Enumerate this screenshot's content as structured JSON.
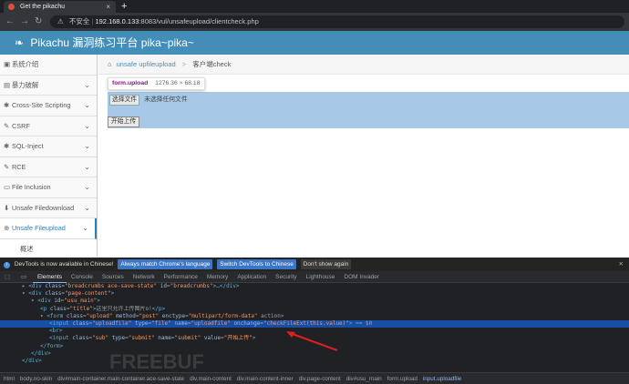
{
  "browser": {
    "tab_title": "Get the pikachu",
    "new_tab_icon": "+",
    "security_label": "不安全",
    "url_host": "192.168.0.133",
    "url_rest": ":8083/vul/unsafeupload/clientcheck.php"
  },
  "site": {
    "title": "Pikachu 漏洞练习平台 pika~pika~"
  },
  "sidebar": {
    "items": [
      {
        "label": "系统介绍",
        "icon": "desktop-icon",
        "chevron": false
      },
      {
        "label": "暴力破解",
        "icon": "list-icon",
        "chevron": true
      },
      {
        "label": "Cross-Site Scripting",
        "icon": "bug-icon",
        "chevron": true
      },
      {
        "label": "CSRF",
        "icon": "edit-icon",
        "chevron": true
      },
      {
        "label": "SQL-Inject",
        "icon": "bug-icon",
        "chevron": true
      },
      {
        "label": "RCE",
        "icon": "wrench-icon",
        "chevron": true
      },
      {
        "label": "File Inclusion",
        "icon": "file-icon",
        "chevron": true
      },
      {
        "label": "Unsafe Filedownload",
        "icon": "download-icon",
        "chevron": true
      },
      {
        "label": "Unsafe Fileupload",
        "icon": "upload-icon",
        "chevron": true,
        "active": true
      },
      {
        "label": "概述",
        "icon": "",
        "chevron": false,
        "sub": true
      }
    ]
  },
  "breadcrumb": {
    "link": "unsafe upfileupload",
    "current": "客户端check"
  },
  "page": {
    "tooltip_name": "form.upload",
    "tooltip_size": "1276.36 × 68.18",
    "choose_button": "选择文件",
    "no_file": "未选择任何文件",
    "submit_label": "开始上传"
  },
  "devtools": {
    "info_text": "DevTools is now available in Chinese!",
    "btn_always": "Always match Chrome's language",
    "btn_switch": "Switch DevTools to Chinese",
    "btn_dont": "Don't show again",
    "tabs": [
      "Elements",
      "Console",
      "Sources",
      "Network",
      "Performance",
      "Memory",
      "Application",
      "Security",
      "Lighthouse",
      "DOM Invader"
    ],
    "lines": [
      {
        "indent": 4,
        "html": "▸ <div class=\"breadcrumbs ace-save-state\" id=\"breadcrumbs\">…</div>"
      },
      {
        "indent": 4,
        "html": "▾ <div class=\"page-content\">"
      },
      {
        "indent": 6,
        "html": "▾ <div id=\"usu_main\">"
      },
      {
        "indent": 8,
        "html": "<p class=\"title\">这里只允许上传图片o!</p>"
      },
      {
        "indent": 8,
        "html": "▾ <form class=\"upload\" method=\"post\" enctype=\"multipart/form-data\" action>"
      },
      {
        "indent": 10,
        "html": "<input class=\"uploadfile\" type=\"file\" name=\"uploadfile\" onchange=\"checkFileExt(this.value)\"> == $0",
        "selected": true
      },
      {
        "indent": 10,
        "html": "<br>"
      },
      {
        "indent": 10,
        "html": "<input class=\"sub\" type=\"submit\" name=\"submit\" value=\"开始上传\">"
      },
      {
        "indent": 8,
        "html": "</form>"
      },
      {
        "indent": 6,
        "html": "</div>"
      },
      {
        "indent": 4,
        "html": "</div>"
      }
    ],
    "crumbs": [
      "html",
      "body.no-skin",
      "div#main-container.main-container.ace-save-state",
      "div.main-content",
      "div.main-content-inner",
      "div.page-content",
      "div#usu_main",
      "form.upload",
      "input.uploadfile"
    ]
  },
  "watermark": "FREEBUF"
}
